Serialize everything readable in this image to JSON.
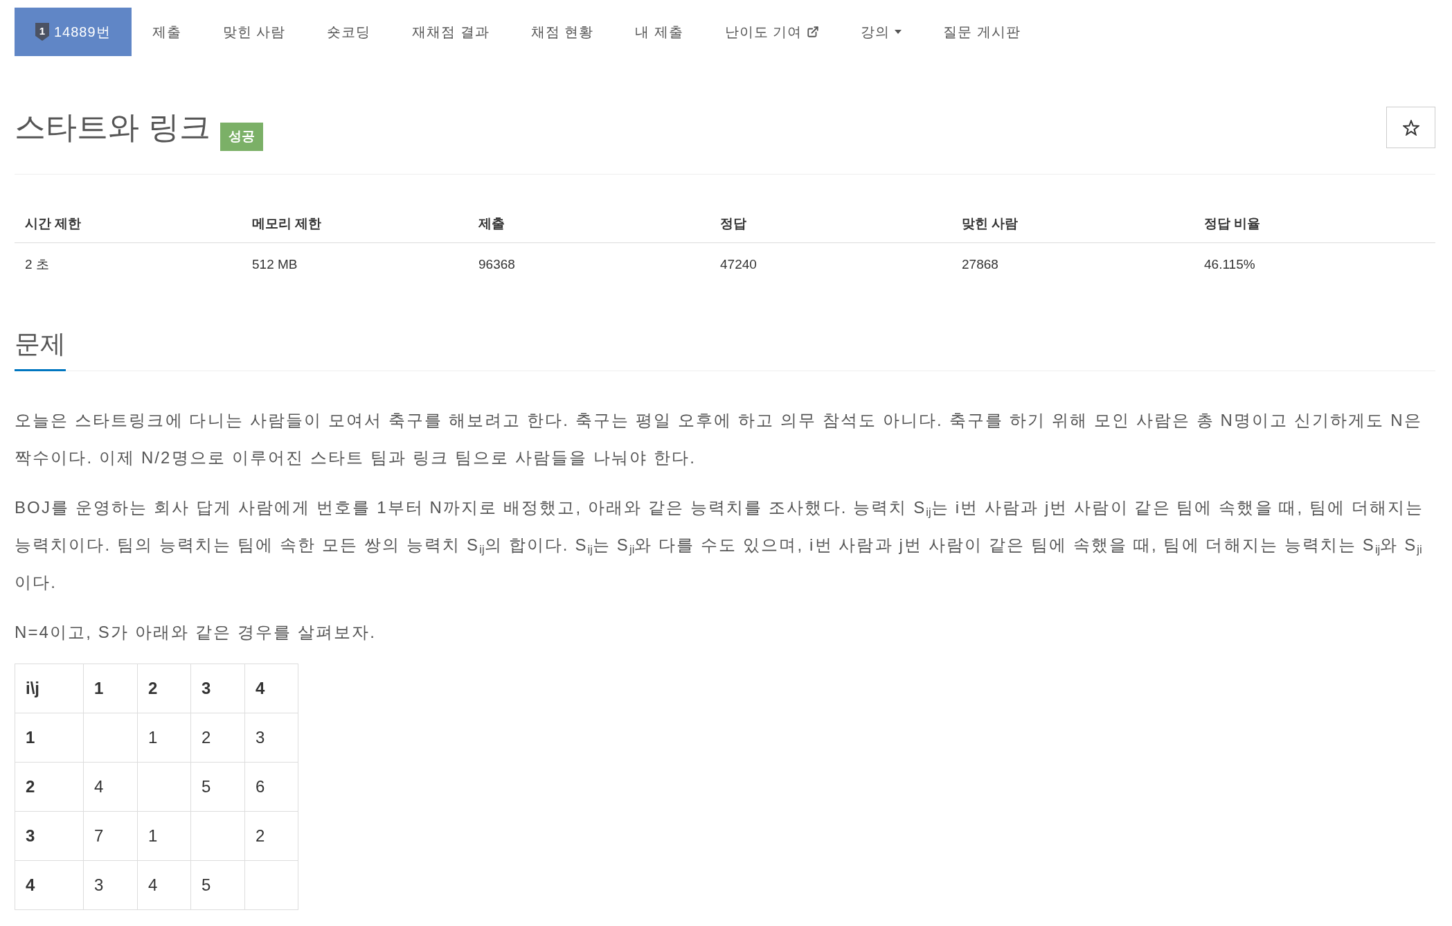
{
  "nav": {
    "tabs": [
      {
        "label": "14889번",
        "kind": "problem",
        "badge": "1",
        "selected": true
      },
      {
        "label": "제출",
        "kind": "plain",
        "selected": false
      },
      {
        "label": "맞힌 사람",
        "kind": "plain",
        "selected": false
      },
      {
        "label": "숏코딩",
        "kind": "plain",
        "selected": false
      },
      {
        "label": "재채점 결과",
        "kind": "plain",
        "selected": false
      },
      {
        "label": "채점 현황",
        "kind": "plain",
        "selected": false
      },
      {
        "label": "내 제출",
        "kind": "plain",
        "selected": false
      },
      {
        "label": "난이도 기여",
        "kind": "external",
        "selected": false
      },
      {
        "label": "강의",
        "kind": "dropdown",
        "selected": false
      },
      {
        "label": "질문 게시판",
        "kind": "plain",
        "selected": false
      }
    ]
  },
  "problem": {
    "title": "스타트와 링크",
    "status": {
      "label": "성공",
      "kind": "success"
    },
    "starred": false
  },
  "info_table": {
    "columns": [
      "시간 제한",
      "메모리 제한",
      "제출",
      "정답",
      "맞힌 사람",
      "정답 비율"
    ],
    "rows": [
      [
        "2 초",
        "512 MB",
        "96368",
        "47240",
        "27868",
        "46.115%"
      ]
    ]
  },
  "section": {
    "heading": "문제",
    "paragraphs": [
      "오늘은 스타트링크에 다니는 사람들이 모여서 축구를 해보려고 한다. 축구는 평일 오후에 하고 의무 참석도 아니다. 축구를 하기 위해 모인 사람은 총 N명이고 신기하게도 N은 짝수이다. 이제 N/2명으로 이루어진 스타트 팀과 링크 팀으로 사람들을 나눠야 한다.",
      "BOJ를 운영하는 회사 답게 사람에게 번호를 1부터 N까지로 배정했고, 아래와 같은 능력치를 조사했다. 능력치 S$_{ij}$는 i번 사람과 j번 사람이 같은 팀에 속했을 때, 팀에 더해지는 능력치이다. 팀의 능력치는 팀에 속한 모든 쌍의 능력치 S$_{ij}$의 합이다. S$_{ij}$는 S$_{ji}$와 다를 수도 있으며, i번 사람과 j번 사람이 같은 팀에 속했을 때, 팀에 더해지는 능력치는 S$_{ij}$와 S$_{ji}$이다.",
      "N=4이고, S가 아래와 같은 경우를 살펴보자."
    ],
    "matrix": {
      "header": [
        "i\\j",
        "1",
        "2",
        "3",
        "4"
      ],
      "rows": [
        [
          "1",
          null,
          "1",
          "2",
          "3"
        ],
        [
          "2",
          "4",
          null,
          "5",
          "6"
        ],
        [
          "3",
          "7",
          "1",
          null,
          "2"
        ],
        [
          "4",
          "3",
          "4",
          "5",
          null
        ]
      ]
    }
  }
}
